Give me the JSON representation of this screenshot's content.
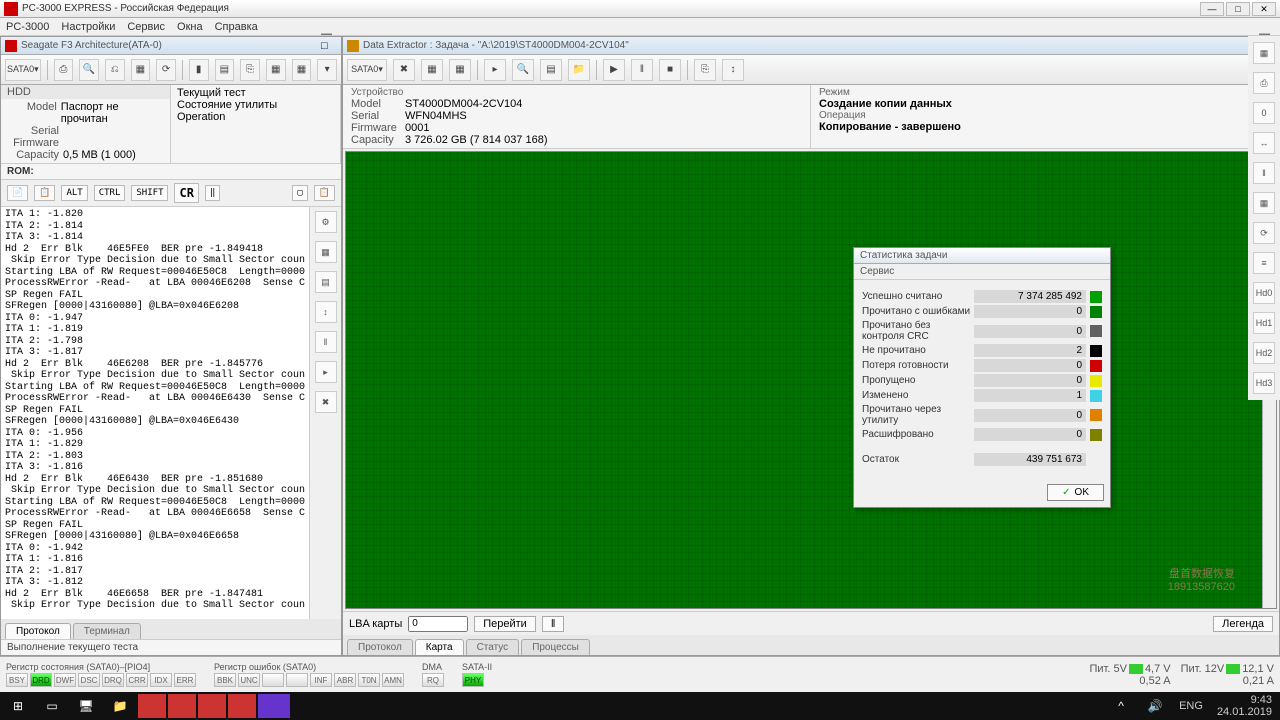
{
  "main_title": "PC-3000 EXPRESS - Российская Федерация",
  "main_menu": [
    "PC-3000",
    "Настройки",
    "Сервис",
    "Окна",
    "Справка"
  ],
  "left": {
    "title": "Seagate F3 Architecture(ATA-0)",
    "hdd_hdr": "HDD",
    "model_lbl": "Model",
    "model_val": "Паспорт не прочитан",
    "serial_lbl": "Serial",
    "fw_lbl": "Firmware",
    "cap_lbl": "Capacity",
    "cap_val": "0,5 MB (1 000)",
    "col2": {
      "l1": "Текущий тест",
      "l2": "Состояние утилиты",
      "l3": "Operation"
    },
    "rom": "ROM:",
    "ctrl": {
      "alt": "ALT",
      "ctrl": "CTRL",
      "shift": "SHIFT",
      "cr": "CR"
    },
    "log": "ITA 1: -1.820\nITA 2: -1.814\nITA 3: -1.814\nHd 2  Err Blk    46E5FE0  BER pre -1.849418\n Skip Error Type Decision due to Small Sector coun\nStarting LBA of RW Request=00046E50C8  Length=0000\nProcessRWError -Read-   at LBA 00046E6208  Sense C\nSP Regen FAIL\nSFRegen [0000|43160080] @LBA=0x046E6208\nITA 0: -1.947\nITA 1: -1.819\nITA 2: -1.798\nITA 3: -1.817\nHd 2  Err Blk    46E6208  BER pre -1.845776\n Skip Error Type Decision due to Small Sector coun\nStarting LBA of RW Request=00046E50C8  Length=0000\nProcessRWError -Read-   at LBA 00046E6430  Sense C\nSP Regen FAIL\nSFRegen [0000|43160080] @LBA=0x046E6430\nITA 0: -1.956\nITA 1: -1.829\nITA 2: -1.803\nITA 3: -1.816\nHd 2  Err Blk    46E6430  BER pre -1.851680\n Skip Error Type Decision due to Small Sector coun\nStarting LBA of RW Request=00046E50C8  Length=0000\nProcessRWError -Read-   at LBA 00046E6658  Sense C\nSP Regen FAIL\nSFRegen [0000|43160080] @LBA=0x046E6658\nITA 0: -1.942\nITA 1: -1.816\nITA 2: -1.817\nITA 3: -1.812\nHd 2  Err Blk    46E6658  BER pre -1.847481\n Skip Error Type Decision due to Small Sector coun",
    "tabs": [
      "Протокол",
      "Терминал"
    ],
    "status": "Выполнение текущего теста"
  },
  "right": {
    "title": "Data Extractor : Задача - \"A:\\2019\\ST4000DM004-2CV104\"",
    "dev_hdr": "Устройство",
    "model_lbl": "Model",
    "model_val": "ST4000DM004-2CV104",
    "serial_lbl": "Serial",
    "serial_val": "WFN04MHS",
    "fw_lbl": "Firmware",
    "fw_val": "0001",
    "cap_lbl": "Capacity",
    "cap_val": "3 726.02 GB (7 814 037 168)",
    "mode_hdr": "Режим",
    "mode_val": "Создание копии данных",
    "op_hdr": "Операция",
    "op_val": "Копирование - завершено",
    "lba_lbl": "LBA карты",
    "lba_val": "0",
    "goto": "Перейти",
    "legend": "Легенда",
    "tabs": [
      "Протокол",
      "Карта",
      "Cтатус",
      "Процессы"
    ]
  },
  "dialog": {
    "title": "Статистика задачи",
    "service": "Сервис",
    "rows": [
      {
        "l": "Успешно считано",
        "v": "7 374 285 492",
        "c": "#00a000"
      },
      {
        "l": "Прочитано с ошибками",
        "v": "0",
        "c": "#008000"
      },
      {
        "l": "Прочитано без контроля CRC",
        "v": "0",
        "c": "#606060"
      },
      {
        "l": "Не прочитано",
        "v": "2",
        "c": "#000000"
      },
      {
        "l": "Потеря готовности",
        "v": "0",
        "c": "#d00000"
      },
      {
        "l": "Пропущено",
        "v": "0",
        "c": "#e8e800"
      },
      {
        "l": "Изменено",
        "v": "1",
        "c": "#40d0e8"
      },
      {
        "l": "Прочитано через утилиту",
        "v": "0",
        "c": "#e08000"
      },
      {
        "l": "Расшифровано",
        "v": "0",
        "c": "#808000"
      }
    ],
    "rest_l": "Остаток",
    "rest_v": "439 751 673",
    "ok": "OK"
  },
  "registers": {
    "state_lbl": "Регистр состояния (SATA0)–[PIO4]",
    "state": [
      "BSY",
      "DRD",
      "DWF",
      "DSC",
      "DRQ",
      "CRR",
      "IDX",
      "ERR"
    ],
    "state_on": [
      false,
      true,
      false,
      false,
      false,
      false,
      false,
      false
    ],
    "err_lbl": "Регистр ошибок  (SATA0)",
    "err": [
      "BBK",
      "UNC",
      "",
      "",
      "INF",
      "ABR",
      "T0N",
      "AMN"
    ],
    "dma_lbl": "DMA",
    "dma": [
      "RQ"
    ],
    "sata_lbl": "SATA-II",
    "sata": [
      "PHY"
    ],
    "sata_on": [
      true
    ]
  },
  "volts": {
    "l1": "Пит. 5V",
    "v1a": "4,7 V",
    "v1b": "0,52 A",
    "l2": "Пит. 12V",
    "v2a": "12,1 V",
    "v2b": "0,21 A"
  },
  "tray": {
    "lang": "ENG",
    "time": "9:43",
    "date": "24.01.2019"
  },
  "watermark": {
    "l1": "盘首数据恢复",
    "l2": "18913587620"
  }
}
